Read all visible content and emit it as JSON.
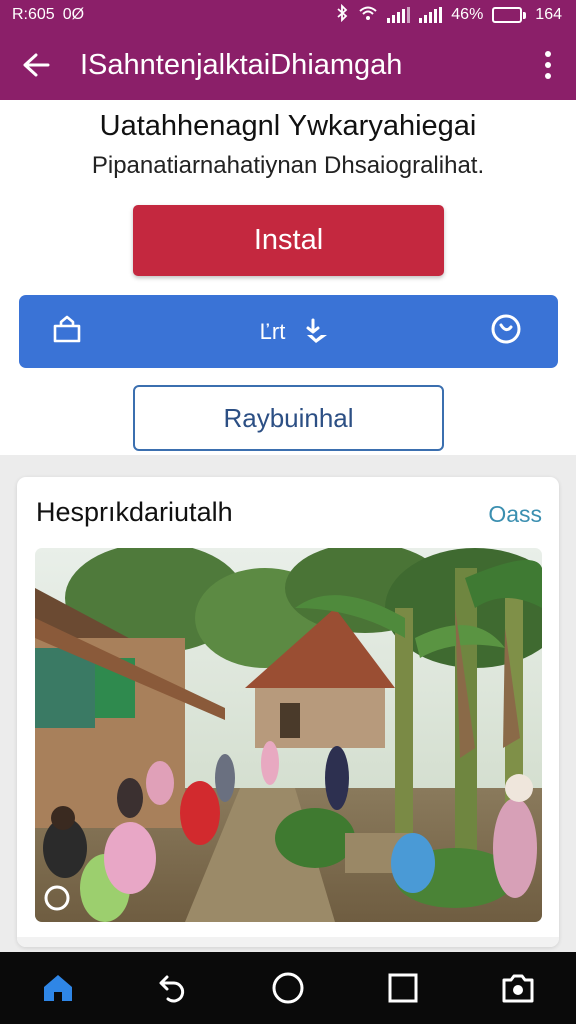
{
  "status_bar": {
    "left_text": "R:605",
    "left_glyph": "0Ø",
    "battery_percent_label": "46%",
    "battery_level": 0.46,
    "time": "164",
    "icons": [
      "bluetooth-icon",
      "wifi-icon",
      "signal-icon",
      "signal-icon",
      "battery-icon"
    ]
  },
  "app_bar": {
    "title": "ISahntenjalktaiDhiamgah",
    "back_icon": "back-arrow-icon",
    "menu_icon": "more-vert-icon",
    "color": "#8b1f69"
  },
  "hero": {
    "title": "Uatahhenagnl Ywkaryahiegai",
    "subtitle": "Pipanatiarnahatiynan Dhsaiogralihat.",
    "install_label": "Instal",
    "install_color": "#c4283f",
    "action_bar": {
      "left_icon": "bag-icon",
      "center_label": "Ľrt",
      "center_icon": "download-icon",
      "right_icon": "chat-icon",
      "color": "#3a73d6"
    },
    "secondary_label": "Raybuinhal"
  },
  "card": {
    "title": "Hesprıkdariutalh",
    "link_label": "Oass",
    "image_alt_icon": "village-photo"
  },
  "nav": {
    "items": [
      "home-icon",
      "back-icon",
      "circle-home-icon",
      "recents-icon",
      "camera-icon"
    ],
    "active_color": "#2f86e6"
  }
}
